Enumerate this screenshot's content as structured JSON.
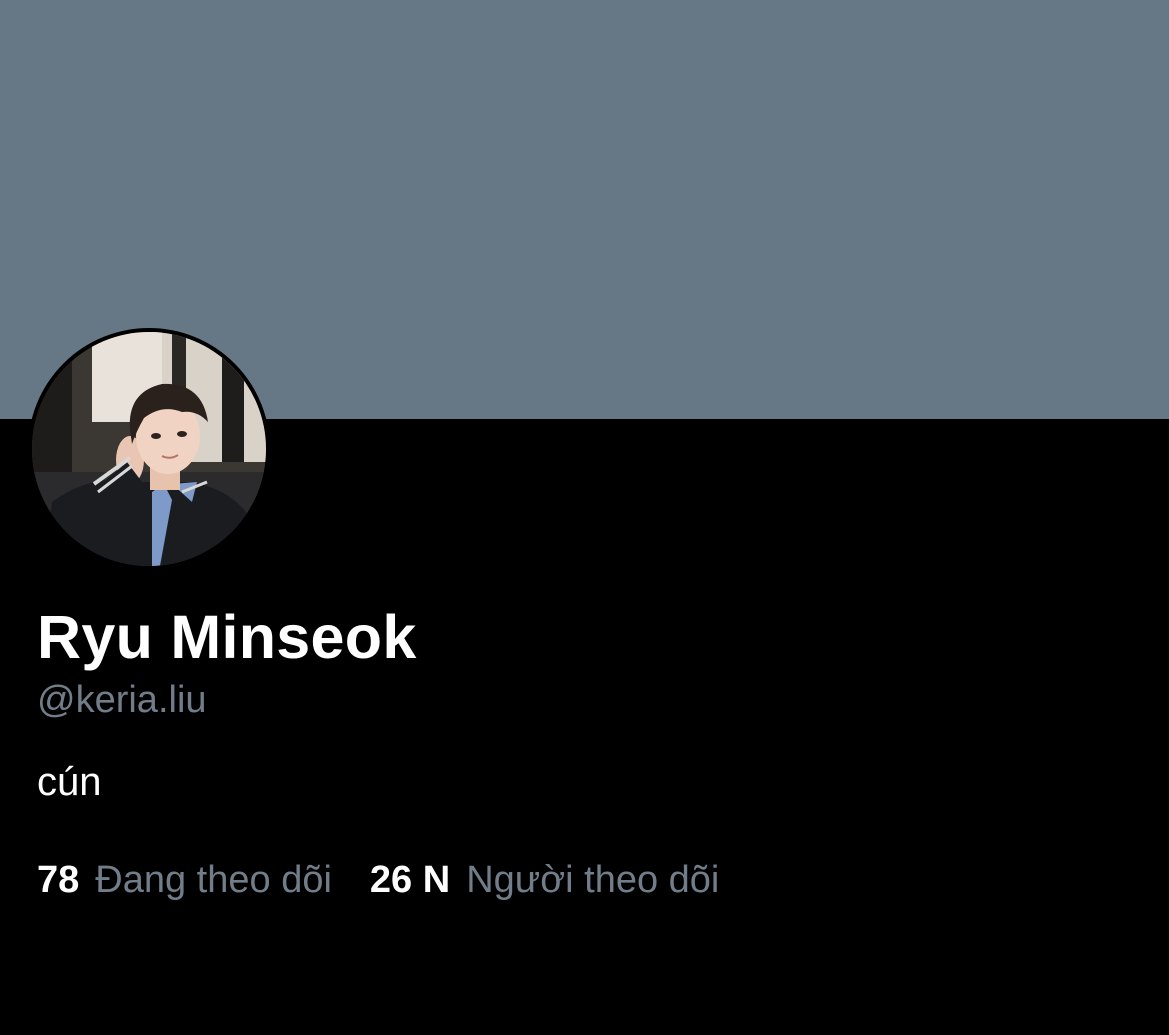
{
  "colors": {
    "banner": "#667785",
    "background": "#000000",
    "primary_text": "#ffffff",
    "secondary_text": "#717d88"
  },
  "profile": {
    "display_name": "Ryu Minseok",
    "handle": "@keria.liu",
    "bio": "cún",
    "avatar_icon": "profile-photo"
  },
  "stats": {
    "following_count": "78",
    "following_label": "Đang theo dõi",
    "followers_count": "26 N",
    "followers_label": "Người theo dõi"
  }
}
